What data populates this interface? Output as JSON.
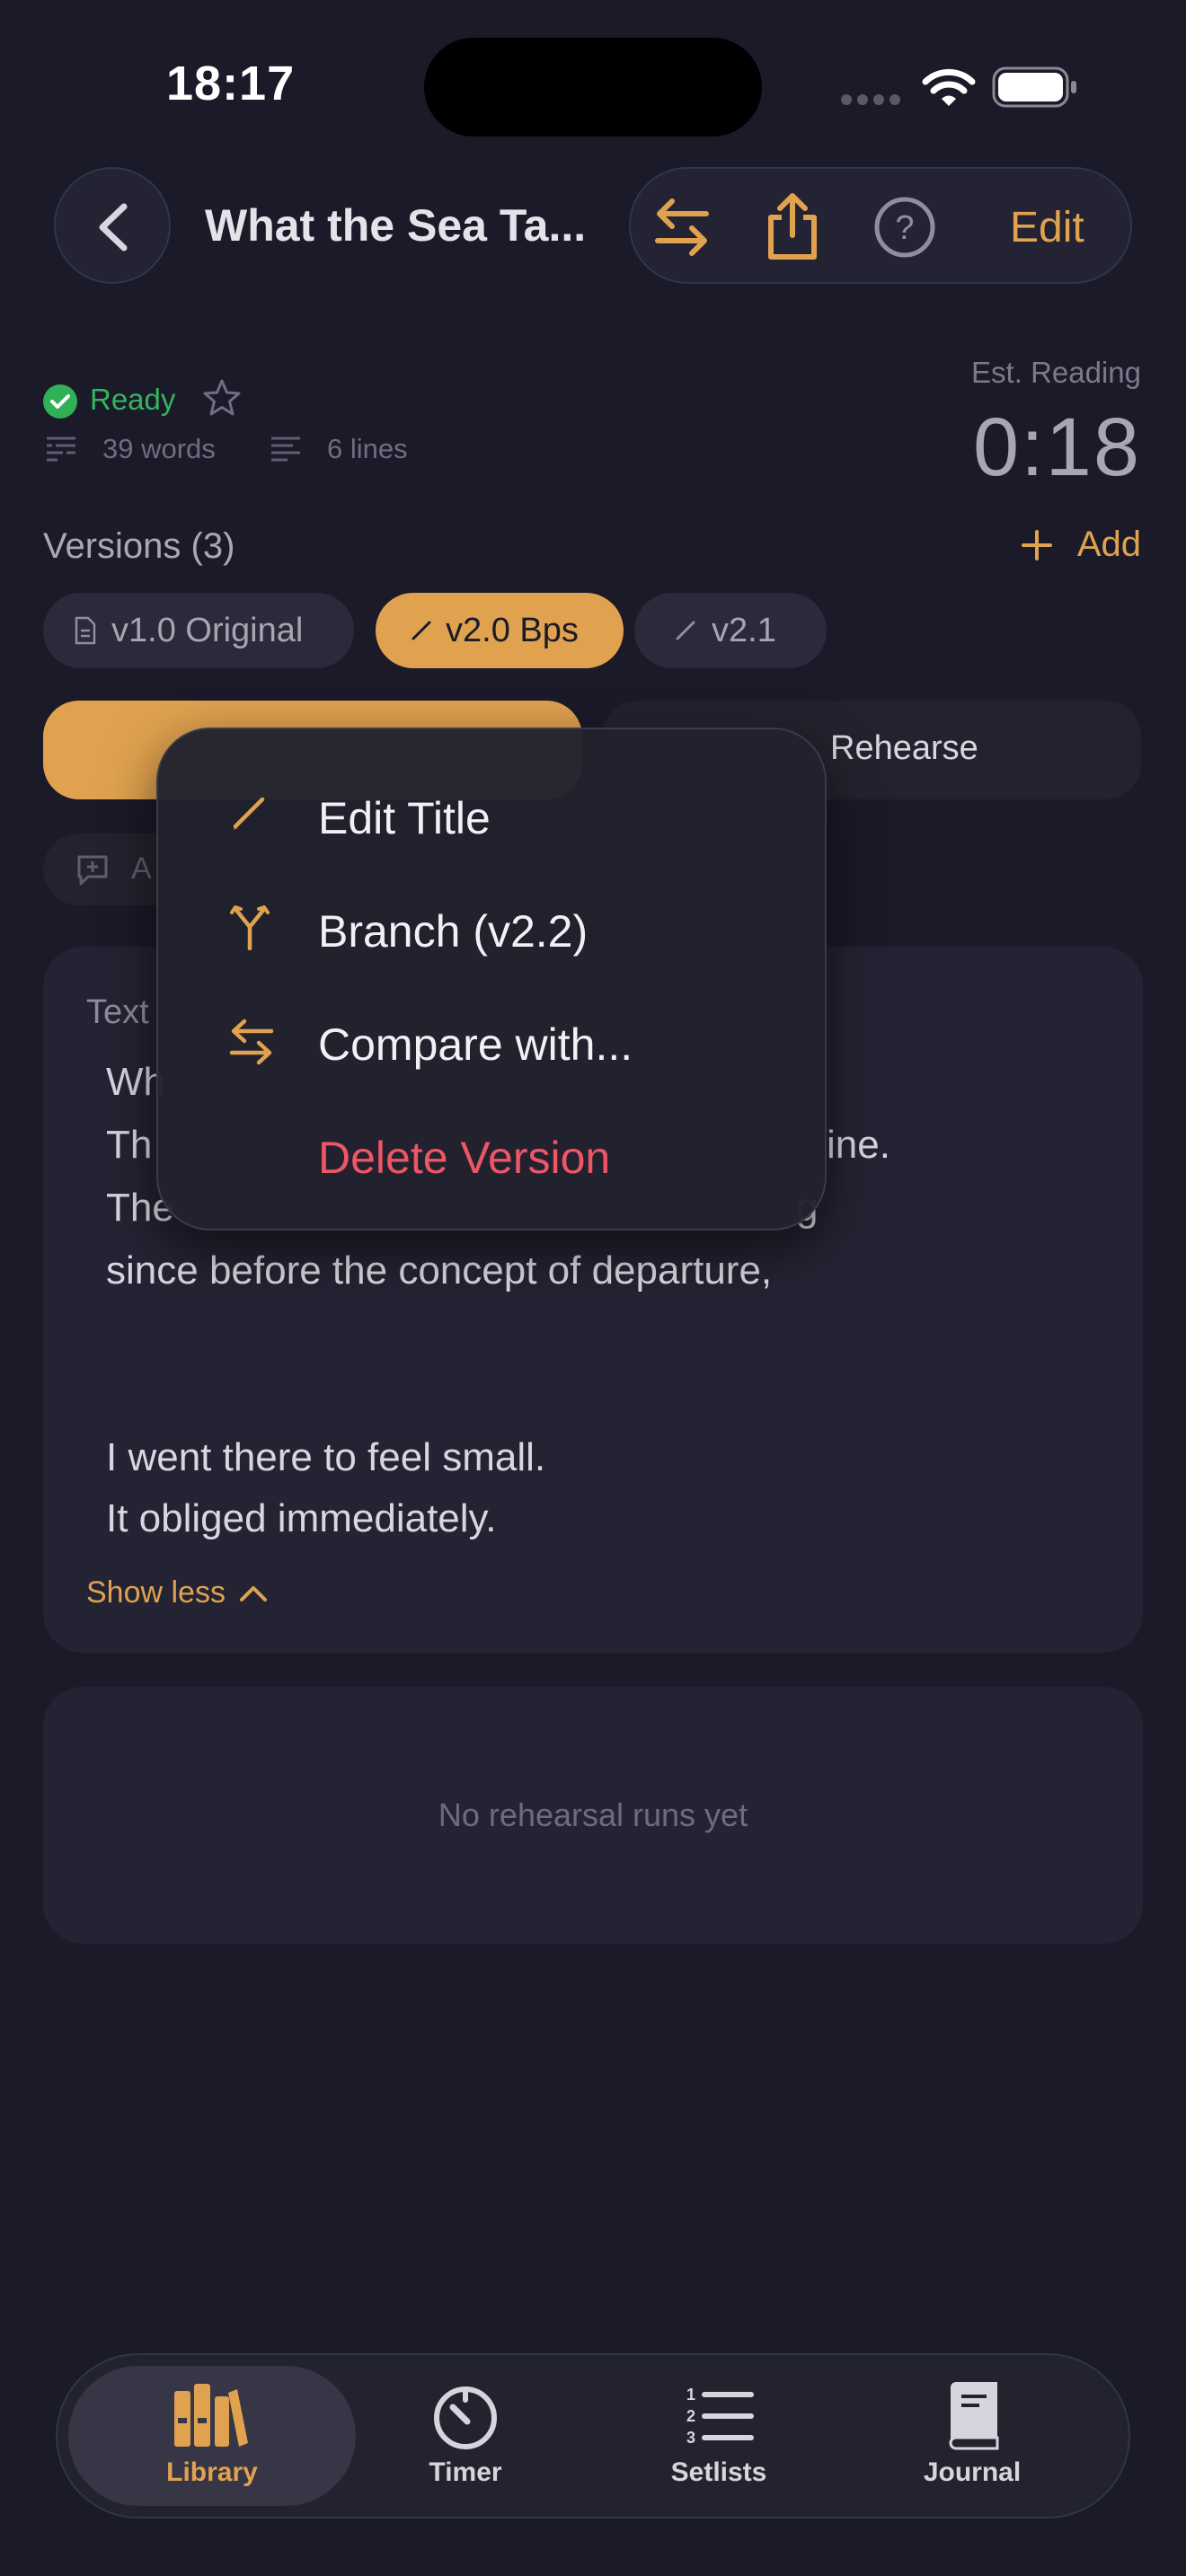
{
  "status_bar": {
    "time": "18:17"
  },
  "nav": {
    "title": "What the Sea Ta...",
    "edit_label": "Edit"
  },
  "meta": {
    "status": "Ready",
    "words": "39 words",
    "lines": "6 lines",
    "est_label": "Est. Reading",
    "est_value": "0:18"
  },
  "versions": {
    "title": "Versions (3)",
    "add_label": "Add",
    "chips": [
      {
        "label": "v1.0 Original",
        "active": false
      },
      {
        "label": "v2.0 Bps",
        "active": true
      },
      {
        "label": "v2.1",
        "active": false
      }
    ]
  },
  "actions": {
    "rehearse_label": "Rehearse",
    "note_label": "A"
  },
  "text_card": {
    "label": "Text",
    "lines": [
      "Wh",
      "Th",
      "The",
      "since before the concept of departure,",
      "",
      "I went there to feel small.",
      "It obliged immediately."
    ],
    "line_tail_2": "ine.",
    "line_tail_3": "g",
    "show_less_label": "Show less"
  },
  "runs_card": {
    "empty_text": "No rehearsal runs yet"
  },
  "context_menu": {
    "items": [
      {
        "label": "Edit Title",
        "icon": "pencil-icon"
      },
      {
        "label": "Branch (v2.2)",
        "icon": "branch-icon"
      },
      {
        "label": "Compare with...",
        "icon": "compare-arrows-icon"
      },
      {
        "label": "Delete Version",
        "icon": "",
        "destructive": true
      }
    ]
  },
  "tab_bar": {
    "tabs": [
      {
        "label": "Library",
        "icon": "books-icon",
        "active": true
      },
      {
        "label": "Timer",
        "icon": "timer-icon",
        "active": false
      },
      {
        "label": "Setlists",
        "icon": "numbered-list-icon",
        "active": false
      },
      {
        "label": "Journal",
        "icon": "journal-icon",
        "active": false
      }
    ]
  },
  "colors": {
    "background": "#1a1a29",
    "accent": "#e0a24f",
    "success": "#30b158",
    "danger": "#ee5565"
  }
}
